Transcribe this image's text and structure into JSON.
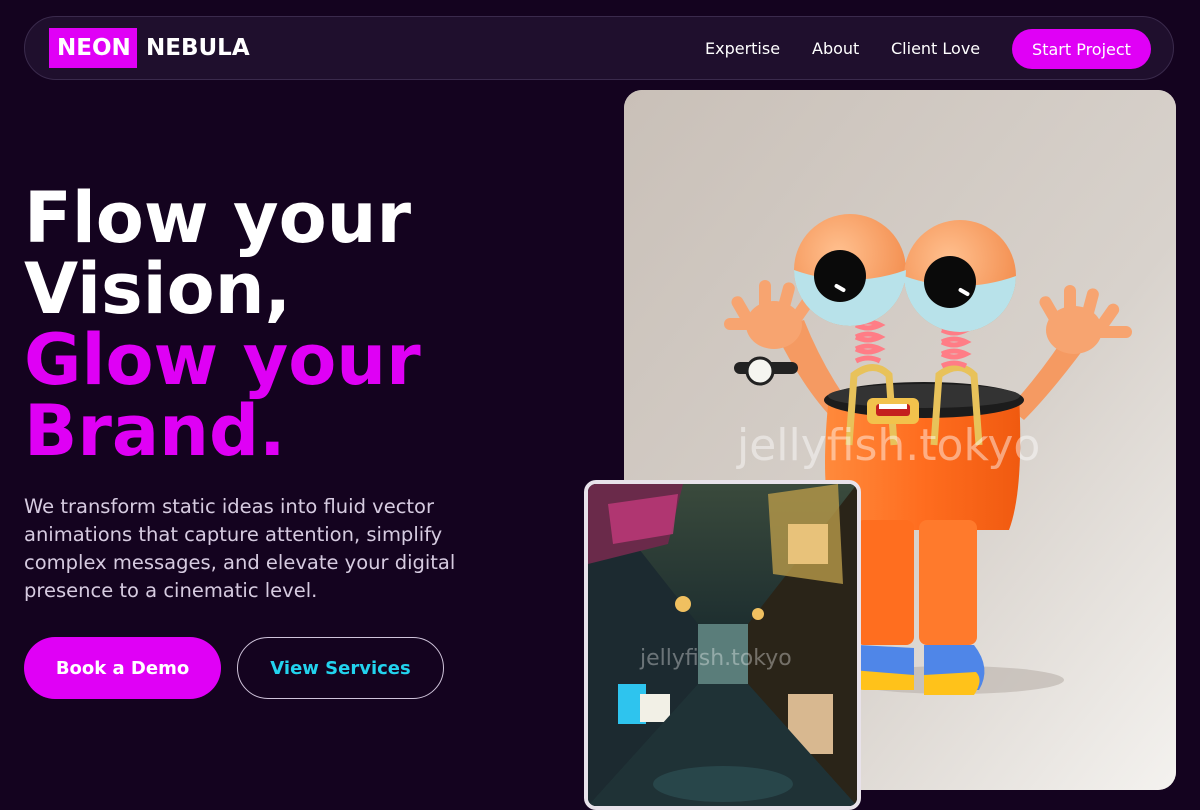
{
  "nav": {
    "logo_highlight": "NEON",
    "logo_rest": "NEBULA",
    "links": [
      "Expertise",
      "About",
      "Client Love"
    ],
    "cta_label": "Start Project"
  },
  "hero": {
    "title_line1": "Flow your",
    "title_line2": "Vision,",
    "title_line3": "Glow your",
    "title_line4": "Brand.",
    "description": "We transform static ideas into fluid vector animations that capture attention, simplify complex messages, and elevate your digital presence to a cinematic level.",
    "primary_button": "Book a Demo",
    "secondary_button": "View Services"
  },
  "media": {
    "watermark_main": "jellyfish.tokyo",
    "watermark_alley": "jellyfish.tokyo"
  },
  "colors": {
    "background": "#14031f",
    "accent_magenta": "#e000f6",
    "accent_cyan": "#22d3ee",
    "nav_bg": "#1f0f2d"
  }
}
